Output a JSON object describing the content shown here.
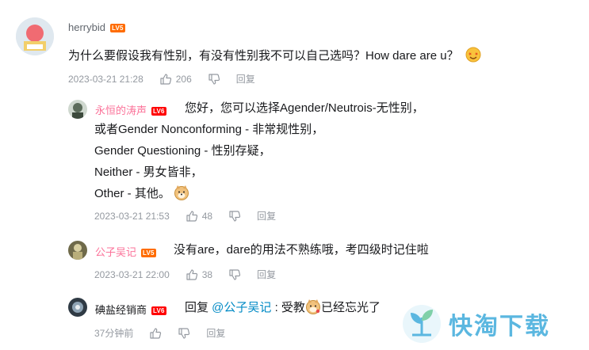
{
  "comment1": {
    "username": "herrybid",
    "level": "LV5",
    "text": "为什么要假设我有性别，有没有性别我不可以自己选吗？How dare are u？",
    "date": "2023-03-21 21:28",
    "likes": "206",
    "reply_label": "回复",
    "emoji": "star-eyes-emoji"
  },
  "reply1": {
    "username": "永恒的涛声",
    "level": "LV6",
    "lines": [
      "您好，您可以选择Agender/Neutrois-无性别，",
      "或者Gender Nonconforming - 非常规性别，",
      "Gender Questioning - 性别存疑，",
      "Neither - 男女皆非，",
      "Other - 其他。"
    ],
    "date": "2023-03-21 21:53",
    "likes": "48",
    "reply_label": "回复",
    "emoji": "doge-emoji"
  },
  "reply2": {
    "username": "公子吴记",
    "level": "LV5",
    "text": "没有are，dare的用法不熟练哦，考四级时记住啦",
    "date": "2023-03-21 22:00",
    "likes": "38",
    "reply_label": "回复"
  },
  "reply3": {
    "username": "碘盐经销商",
    "level": "LV6",
    "prefix": "回复 ",
    "mention": "@公子吴记",
    "colon": " : ",
    "text_before": "受教",
    "text_after": "已经忘光了",
    "date": "37分钟前",
    "reply_label": "回复",
    "emoji": "doge-emoji"
  },
  "watermark": {
    "text": "快淘下载",
    "icon": "leaf-logo-icon"
  }
}
